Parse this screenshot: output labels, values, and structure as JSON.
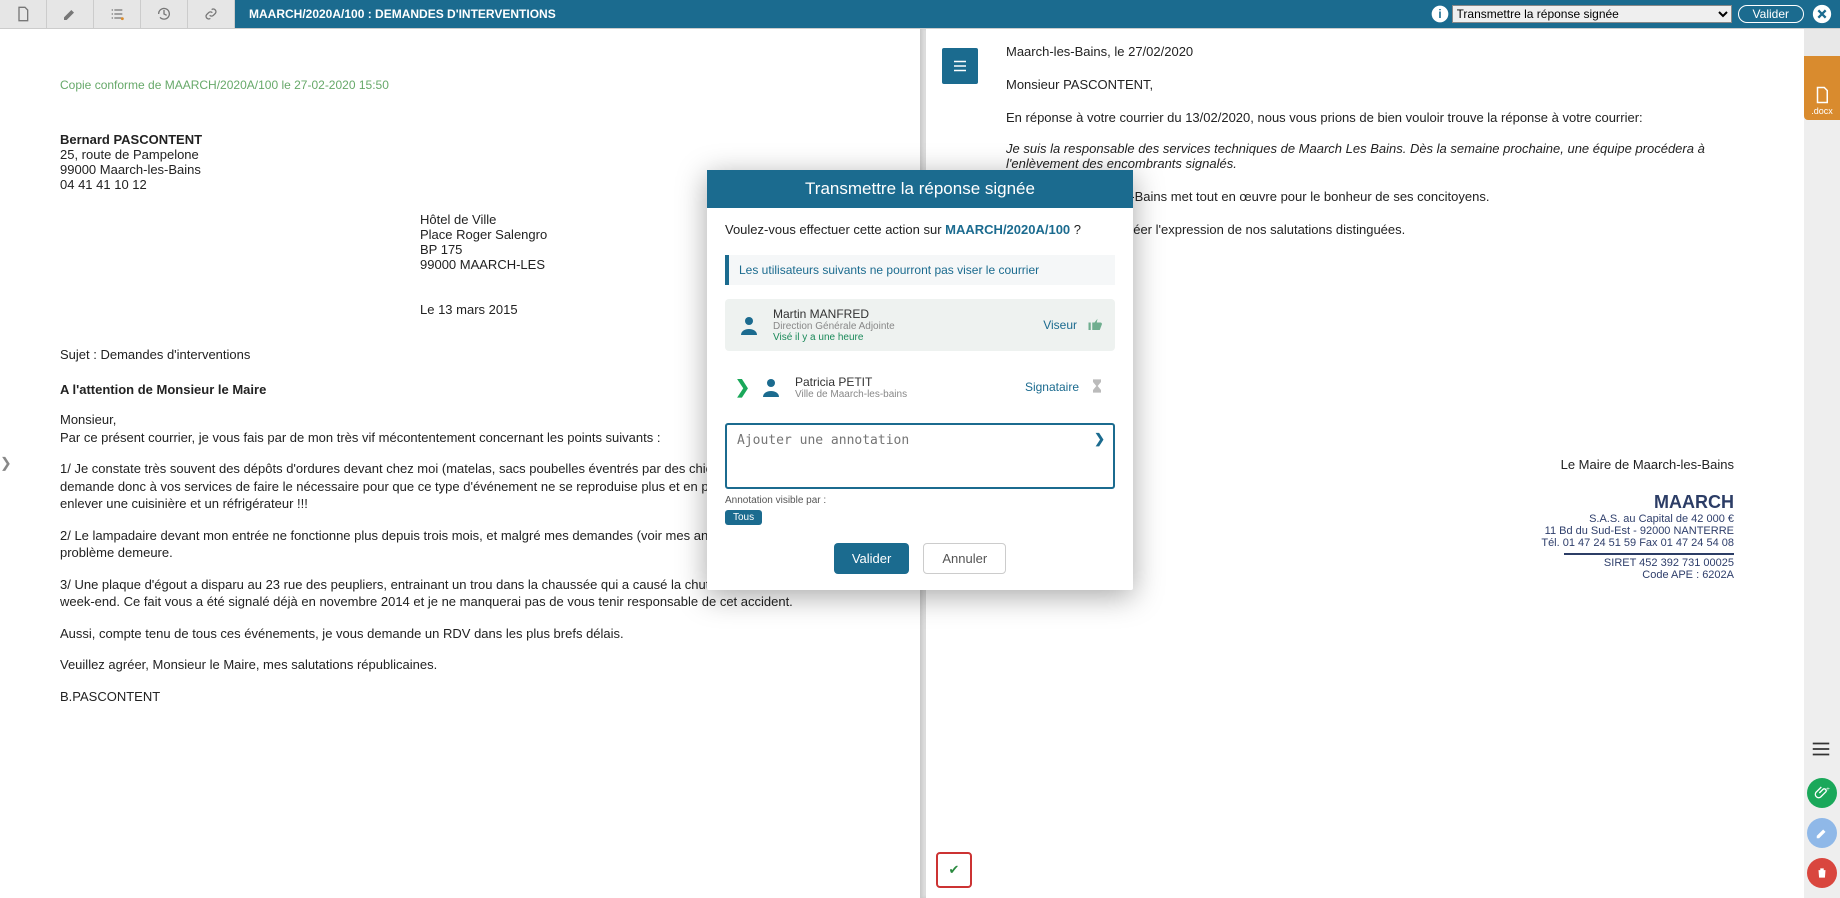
{
  "topbar": {
    "breadcrumb": "MAARCH/2020A/100 : DEMANDES D'INTERVENTIONS",
    "action_select": "Transmettre la réponse signée",
    "valider": "Valider"
  },
  "left_doc": {
    "copy_line": "Copie conforme de MAARCH/2020A/100 le 27-02-2020 15:50",
    "sender_name": "Bernard PASCONTENT",
    "sender_addr1": "25, route de Pampelone",
    "sender_addr2": "99000 Maarch-les-Bains",
    "sender_tel": "04 41 41 10 12",
    "dest1": "Hôtel de Ville",
    "dest2": "Place Roger Salengro",
    "dest3": "BP 175",
    "dest4": "99000 MAARCH-LES",
    "date": "Le 13 mars 2015",
    "subject": "Sujet : Demandes d'interventions",
    "attention": "A l'attention de Monsieur le Maire",
    "p1": "Monsieur,\nPar ce présent courrier, je vous fais par de mon très vif mécontentement concernant les points suivants :",
    "p2": "1/ Je constate très souvent des dépôts d'ordures devant chez moi (matelas, sacs poubelles éventrés par des chiens errants,....), je demande donc à vos services de faire le nécessaire pour que ce type d'événement ne se reproduise plus et en particulier d'intervenir pour enlever une cuisinière et un réfrigérateur !!!",
    "p3": "2/ Le lampadaire devant mon entrée ne fonctionne plus depuis trois mois, et malgré mes demandes (voir mes anciens courriers) ce problème demeure.",
    "p4": "3/ Une plaque d'égout a disparu au 23 rue des peupliers, entrainant un trou dans la chaussée qui a causé la chute de vélo de mon fils ce week-end. Ce fait vous a été signalé déjà en novembre 2014 et je ne manquerai pas de vous tenir responsable de cet accident.",
    "p5": "Aussi, compte tenu de tous ces événements, je vous demande un RDV dans les plus brefs délais.",
    "p6": "Veuillez agréer, Monsieur le Maire, mes salutations républicaines.",
    "sign": "B.PASCONTENT"
  },
  "right_doc": {
    "l1": "Maarch-les-Bains, le 27/02/2020",
    "l2": "Monsieur PASCONTENT,",
    "l3": "En réponse à votre courrier du 13/02/2020, nous vous prions de bien vouloir trouve la réponse à votre courrier:",
    "l4": "Je suis la responsable des services techniques de Maarch Les Bains. Dès la semaine prochaine, une équipe procédera à l'enlèvement des encombrants signalés.",
    "l5": "Maarch-les-Bains met tout en œuvre pour le bonheur de ses concitoyens.",
    "l6": "Veuillez agréer l'expression de nos salutations distinguées.",
    "mayor": "Le Maire de Maarch-les-Bains",
    "sig_brand": "MAARCH",
    "sig_l1": "S.A.S. au Capital de 42 000 €",
    "sig_l2": "11 Bd du Sud-Est - 92000 NANTERRE",
    "sig_l3": "Tél. 01 47 24 51 59 Fax 01 47 24 54 08",
    "sig_l4": "SIRET 452 392 731 00025",
    "sig_l5": "Code APE : 6202A"
  },
  "modal": {
    "title": "Transmettre la réponse signée",
    "confirm_pre": "Voulez-vous effectuer cette action sur ",
    "confirm_ref": "MAARCH/2020A/100",
    "confirm_post": " ?",
    "warn": "Les utilisateurs suivants ne pourront pas viser le courrier",
    "u1_name": "Martin MANFRED",
    "u1_sub": "Direction Générale Adjointe",
    "u1_vis": "Visé il y a une heure",
    "u1_role": "Viseur",
    "u2_name": "Patricia PETIT",
    "u2_sub": "Ville de Maarch-les-bains",
    "u2_role": "Signataire",
    "annot_ph": "Ajouter une annotation",
    "vis_label": "Annotation visible par :",
    "vis_all": "Tous",
    "ok": "Valider",
    "cancel": "Annuler"
  },
  "side": {
    "docx": ".docx"
  }
}
